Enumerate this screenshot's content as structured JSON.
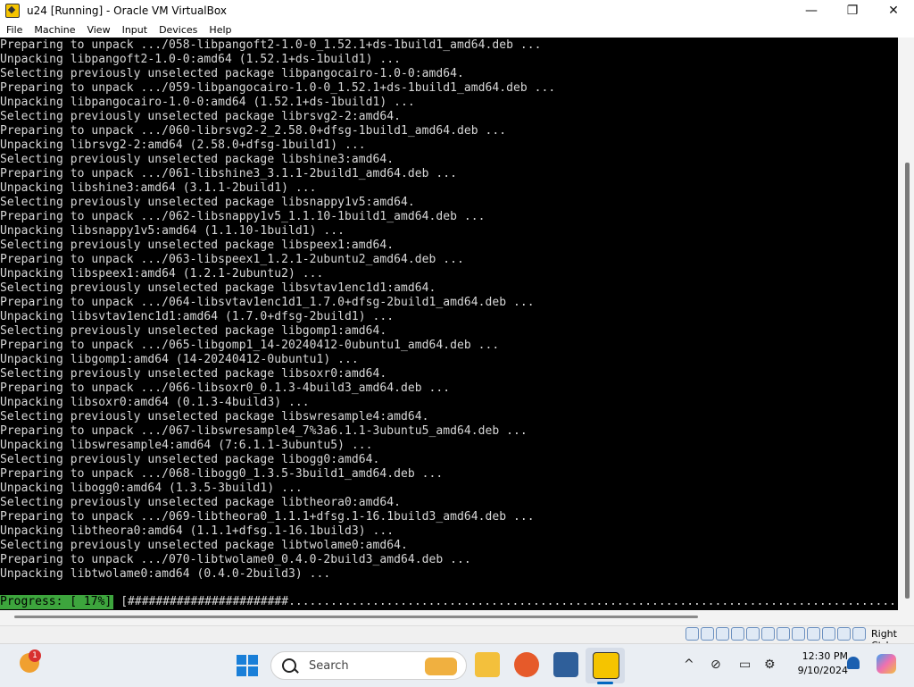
{
  "window": {
    "title": "u24 [Running] - Oracle VM VirtualBox",
    "minimize": "—",
    "maximize": "❐",
    "close": "✕"
  },
  "menu": [
    "File",
    "Machine",
    "View",
    "Input",
    "Devices",
    "Help"
  ],
  "terminal": {
    "lines": [
      "Preparing to unpack .../058-libpangoft2-1.0-0_1.52.1+ds-1build1_amd64.deb ...",
      "Unpacking libpangoft2-1.0-0:amd64 (1.52.1+ds-1build1) ...",
      "Selecting previously unselected package libpangocairo-1.0-0:amd64.",
      "Preparing to unpack .../059-libpangocairo-1.0-0_1.52.1+ds-1build1_amd64.deb ...",
      "Unpacking libpangocairo-1.0-0:amd64 (1.52.1+ds-1build1) ...",
      "Selecting previously unselected package librsvg2-2:amd64.",
      "Preparing to unpack .../060-librsvg2-2_2.58.0+dfsg-1build1_amd64.deb ...",
      "Unpacking librsvg2-2:amd64 (2.58.0+dfsg-1build1) ...",
      "Selecting previously unselected package libshine3:amd64.",
      "Preparing to unpack .../061-libshine3_3.1.1-2build1_amd64.deb ...",
      "Unpacking libshine3:amd64 (3.1.1-2build1) ...",
      "Selecting previously unselected package libsnappy1v5:amd64.",
      "Preparing to unpack .../062-libsnappy1v5_1.1.10-1build1_amd64.deb ...",
      "Unpacking libsnappy1v5:amd64 (1.1.10-1build1) ...",
      "Selecting previously unselected package libspeex1:amd64.",
      "Preparing to unpack .../063-libspeex1_1.2.1-2ubuntu2_amd64.deb ...",
      "Unpacking libspeex1:amd64 (1.2.1-2ubuntu2) ...",
      "Selecting previously unselected package libsvtav1enc1d1:amd64.",
      "Preparing to unpack .../064-libsvtav1enc1d1_1.7.0+dfsg-2build1_amd64.deb ...",
      "Unpacking libsvtav1enc1d1:amd64 (1.7.0+dfsg-2build1) ...",
      "Selecting previously unselected package libgomp1:amd64.",
      "Preparing to unpack .../065-libgomp1_14-20240412-0ubuntu1_amd64.deb ...",
      "Unpacking libgomp1:amd64 (14-20240412-0ubuntu1) ...",
      "Selecting previously unselected package libsoxr0:amd64.",
      "Preparing to unpack .../066-libsoxr0_0.1.3-4build3_amd64.deb ...",
      "Unpacking libsoxr0:amd64 (0.1.3-4build3) ...",
      "Selecting previously unselected package libswresample4:amd64.",
      "Preparing to unpack .../067-libswresample4_7%3a6.1.1-3ubuntu5_amd64.deb ...",
      "Unpacking libswresample4:amd64 (7:6.1.1-3ubuntu5) ...",
      "Selecting previously unselected package libogg0:amd64.",
      "Preparing to unpack .../068-libogg0_1.3.5-3build1_amd64.deb ...",
      "Unpacking libogg0:amd64 (1.3.5-3build1) ...",
      "Selecting previously unselected package libtheora0:amd64.",
      "Preparing to unpack .../069-libtheora0_1.1.1+dfsg.1-16.1build3_amd64.deb ...",
      "Unpacking libtheora0:amd64 (1.1.1+dfsg.1-16.1build3) ...",
      "Selecting previously unselected package libtwolame0:amd64.",
      "Preparing to unpack .../070-libtwolame0_0.4.0-2build3_amd64.deb ...",
      "Unpacking libtwolame0:amd64 (0.4.0-2build3) ..."
    ],
    "progress_label": "Progress: [ 17%]",
    "progress_bar": "[#######################.................................................................................................................]",
    "progress_percent": 17
  },
  "statusbar": {
    "host_key": "Right Ctrl",
    "icons": [
      "hard-disk-icon",
      "optical-drive-icon",
      "audio-icon",
      "network-icon",
      "usb-icon",
      "shared-folders-icon",
      "display-icon",
      "recording-icon",
      "mouse-integration-icon",
      "cpu-icon",
      "keyboard-icon",
      "capture-icon"
    ]
  },
  "taskbar": {
    "weather_badge": "1",
    "search_placeholder": "Search",
    "tray_icons": [
      "^",
      "⊘",
      "▭",
      "⚙"
    ],
    "time": "12:30 PM",
    "date": "9/10/2024"
  },
  "colors": {
    "terminal_bg": "#000000",
    "terminal_fg": "#d8d8d8",
    "progress_green": "#3da53d",
    "accent": "#0067c0"
  }
}
